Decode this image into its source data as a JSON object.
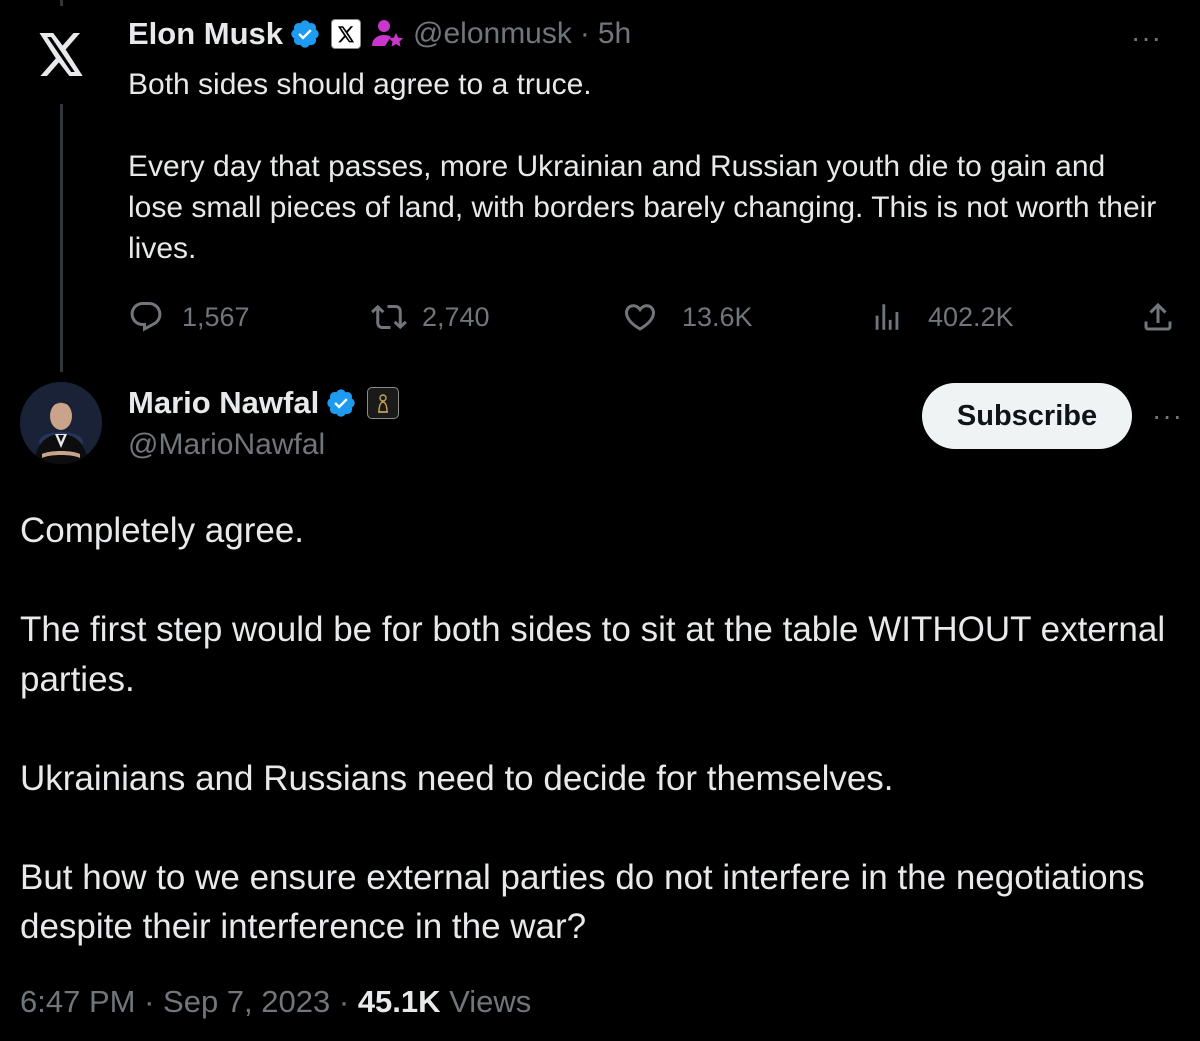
{
  "parent_tweet": {
    "author_name": "Elon Musk",
    "handle": "@elonmusk",
    "separator": "·",
    "time_ago": "5h",
    "text_paragraphs": [
      "Both sides should agree to a truce.",
      "Every day that passes, more Ukrainian and Russian youth die to gain and lose small pieces of land, with borders barely changing. This is not worth their lives."
    ],
    "more_label": "···",
    "stats": {
      "replies": "1,567",
      "reposts": "2,740",
      "likes": "13.6K",
      "views": "402.2K"
    },
    "icons": [
      "x-logo-icon",
      "verified-badge-icon",
      "x-affiliate-badge-icon",
      "person-star-icon",
      "reply-icon",
      "repost-icon",
      "like-icon",
      "views-icon",
      "share-icon"
    ]
  },
  "main_tweet": {
    "author_name": "Mario Nawfal",
    "handle": "@MarioNawfal",
    "subscribe_label": "Subscribe",
    "more_label": "···",
    "text_paragraphs": [
      "Completely agree.",
      "The first step would be for both sides to sit at the table WITHOUT external parties.",
      "Ukrainians and Russians need to decide for themselves.",
      "But how to we ensure external parties do not interfere in the negotiations despite their interference in the war?"
    ],
    "timestamp": "6:47 PM",
    "date": "Sep 7, 2023",
    "separator": "·",
    "view_count": "45.1K",
    "views_label": "Views"
  },
  "colors": {
    "background": "#000000",
    "text_primary": "#e7e9ea",
    "text_secondary": "#71767b",
    "verified_blue": "#1d9bf0",
    "subscribe_bg": "#eff3f4",
    "person_star_purple": "#c936cc"
  }
}
